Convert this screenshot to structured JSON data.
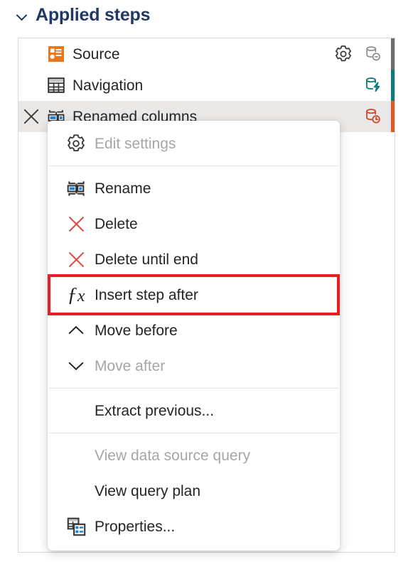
{
  "section": {
    "title": "Applied steps",
    "chevron_icon": "chevron-down-icon",
    "expanded": true
  },
  "colors": {
    "title": "#1F3864",
    "source_icon": "#E8761B",
    "db_gray": "#8A8886",
    "db_teal": "#0F7A7D",
    "db_red": "#D04A2A",
    "accent_gray": "#6E6E6E",
    "accent_teal": "#0F7A7D",
    "accent_orange": "#DE5B1F",
    "delete_x": "#E8443A",
    "highlight_box": "#EC1C24",
    "selected_row": "#EBE9E7",
    "panel_border": "#D6D6D6"
  },
  "steps": [
    {
      "label": "Source",
      "icon": "source-step-icon",
      "selected": false,
      "has_gear": true,
      "gear_icon": "gear-icon",
      "status_icon": "database-minus-icon",
      "status_color": "#8A8886",
      "accent_color": "#6E6E6E"
    },
    {
      "label": "Navigation",
      "icon": "table-step-icon",
      "selected": false,
      "has_gear": false,
      "status_icon": "database-lightning-icon",
      "status_color": "#0F7A7D",
      "accent_color": "#0F7A7D"
    },
    {
      "label": "Renamed columns",
      "icon": "rename-columns-step-icon",
      "selected": true,
      "has_gear": false,
      "delete_icon": "close-icon",
      "status_icon": "database-clock-icon",
      "status_color": "#D04A2A",
      "accent_color": "#DE5B1F"
    }
  ],
  "context_menu": {
    "items": [
      {
        "id": "edit-settings",
        "label": "Edit settings",
        "icon": "gear-icon",
        "disabled": true,
        "separator_after": true
      },
      {
        "id": "rename",
        "label": "Rename",
        "icon": "rename-icon",
        "disabled": false,
        "separator_after": false
      },
      {
        "id": "delete",
        "label": "Delete",
        "icon": "delete-x-icon",
        "disabled": false,
        "separator_after": false
      },
      {
        "id": "delete-until-end",
        "label": "Delete until end",
        "icon": "delete-x-icon",
        "disabled": false,
        "separator_after": false
      },
      {
        "id": "insert-step-after",
        "label": "Insert step after",
        "icon": "fx-icon",
        "disabled": false,
        "separator_after": false,
        "highlighted": true
      },
      {
        "id": "move-before",
        "label": "Move before",
        "icon": "chevron-up-icon",
        "disabled": false,
        "separator_after": false
      },
      {
        "id": "move-after",
        "label": "Move after",
        "icon": "chevron-down-icon",
        "disabled": true,
        "separator_after": true
      },
      {
        "id": "extract-previous",
        "label": "Extract previous...",
        "icon": "",
        "disabled": false,
        "separator_after": true
      },
      {
        "id": "view-data-source-query",
        "label": "View data source query",
        "icon": "",
        "disabled": true,
        "separator_after": false
      },
      {
        "id": "view-query-plan",
        "label": "View query plan",
        "icon": "",
        "disabled": false,
        "separator_after": false
      },
      {
        "id": "properties",
        "label": "Properties...",
        "icon": "properties-icon",
        "disabled": false,
        "separator_after": false
      }
    ]
  }
}
